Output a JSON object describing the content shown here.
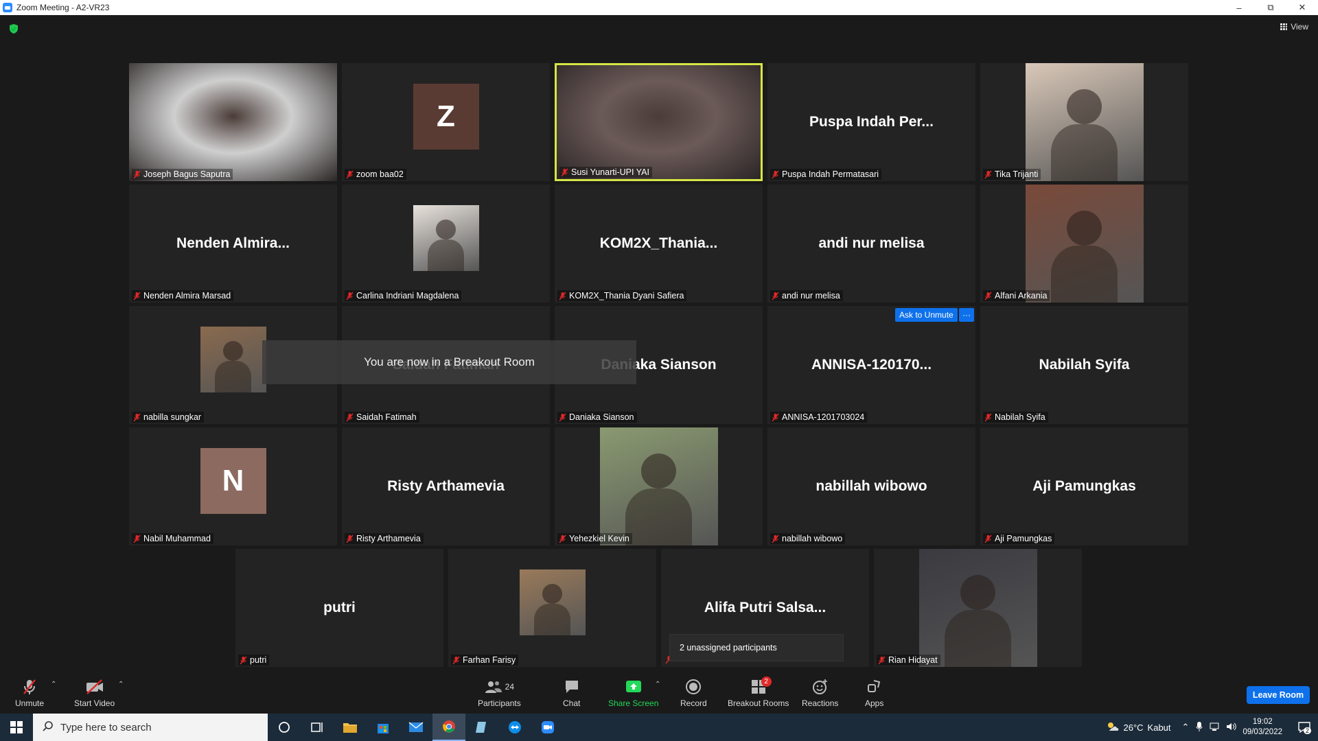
{
  "window": {
    "title": "Zoom Meeting - A2-VR23",
    "view_label": "View"
  },
  "tiles": [
    {
      "label": "Joseph Bagus Saputra",
      "kind": "video",
      "bg": "#cfcfcf"
    },
    {
      "label": "zoom baa02",
      "kind": "letter",
      "letter": "Z",
      "letter_bg": "#5a3b33"
    },
    {
      "label": "Susi Yunarti-UPI YAI",
      "kind": "video",
      "bg": "#6b5a58",
      "active": true
    },
    {
      "label": "Puspa Indah Permatasari",
      "kind": "name",
      "display": "Puspa Indah Per..."
    },
    {
      "label": "Tika Trijanti",
      "kind": "photo",
      "bg": "#d9c8b8"
    },
    {
      "label": "Nenden Almira Marsad",
      "kind": "name",
      "display": "Nenden  Almira..."
    },
    {
      "label": "Carlina Indriani Magdalena",
      "kind": "photo-small",
      "bg": "#e8e2dc"
    },
    {
      "label": "KOM2X_Thania Dyani Safiera",
      "kind": "name",
      "display": "KOM2X_Thania..."
    },
    {
      "label": "andi nur melisa",
      "kind": "name",
      "display": "andi nur melisa"
    },
    {
      "label": "Alfani Arkania",
      "kind": "photo",
      "bg": "#7a4a3a"
    },
    {
      "label": "nabilla sungkar",
      "kind": "photo-small",
      "bg": "#8a6a4e"
    },
    {
      "label": "Saidah Fatimah",
      "kind": "name",
      "display": "Saidah Fatimah"
    },
    {
      "label": "Daniaka Sianson",
      "kind": "name",
      "display": "Daniaka Sianson"
    },
    {
      "label": "ANNISA-1201703024",
      "kind": "name",
      "display": "ANNISA-120170..."
    },
    {
      "label": "Nabilah Syifa",
      "kind": "name",
      "display": "Nabilah Syifa"
    },
    {
      "label": "Nabil Muhammad",
      "kind": "letter",
      "letter": "N",
      "letter_bg": "#8c6a60"
    },
    {
      "label": "Risty Arthamevia",
      "kind": "name",
      "display": "Risty Arthamevia"
    },
    {
      "label": "Yehezkiel Kevin",
      "kind": "photo",
      "bg": "#8a9a70"
    },
    {
      "label": "nabillah wibowo",
      "kind": "name",
      "display": "nabillah wibowo"
    },
    {
      "label": "Aji Pamungkas",
      "kind": "name",
      "display": "Aji Pamungkas"
    },
    {
      "label": "putri",
      "kind": "name",
      "display": "putri"
    },
    {
      "label": "Farhan Farisy",
      "kind": "photo-small",
      "bg": "#9a7a5a"
    },
    {
      "label": "",
      "kind": "name",
      "display": "Alifa Putri Salsa..."
    },
    {
      "label": "Rian Hidayat",
      "kind": "photo",
      "bg": "#3a3a40"
    }
  ],
  "overlays": {
    "breakout_message": "You are now in a Breakout Room",
    "ask_to_unmute": "Ask to Unmute",
    "more": "···",
    "unassigned": "2 unassigned participants"
  },
  "toolbar": {
    "unmute": "Unmute",
    "start_video": "Start Video",
    "participants": "Participants",
    "participants_count": "24",
    "chat": "Chat",
    "share_screen": "Share Screen",
    "record": "Record",
    "breakout_rooms": "Breakout Rooms",
    "breakout_badge": "2",
    "reactions": "Reactions",
    "apps": "Apps",
    "leave_room": "Leave Room"
  },
  "taskbar": {
    "search_placeholder": "Type here to search",
    "weather_temp": "26°C",
    "weather_desc": "Kabut",
    "time": "19:02",
    "date": "09/03/2022",
    "notif_count": "2"
  },
  "colors": {
    "active_border": "#d5e646",
    "accent": "#0e71eb",
    "share_green": "#23d959",
    "muted_red": "#e02828"
  }
}
